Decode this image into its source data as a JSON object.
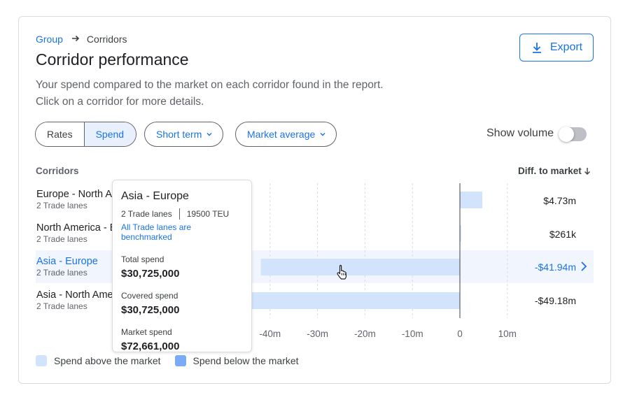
{
  "breadcrumb": {
    "parent": "Group",
    "current": "Corridors"
  },
  "page": {
    "title": "Corridor performance",
    "subtitle_line1": "Your spend compared to the market on each corridor found in the report.",
    "subtitle_line2": "Click on a corridor for more details."
  },
  "toolbar": {
    "export_label": "Export",
    "segments": [
      "Rates",
      "Spend"
    ],
    "active_segment": "Spend",
    "term_dropdown": "Short term",
    "benchmark_dropdown": "Market average",
    "show_volume_label": "Show volume",
    "show_volume_on": false
  },
  "table": {
    "col_left": "Corridors",
    "col_right": "Diff. to market",
    "sort_icon": "arrow-down-icon",
    "rows": [
      {
        "name": "Europe - North America",
        "sub": "2 Trade lanes",
        "value": "$4.73m"
      },
      {
        "name": "North America - Europe",
        "sub": "2 Trade lanes",
        "value": "$261k"
      },
      {
        "name": "Asia - Europe",
        "sub": "2 Trade lanes",
        "value": "-$41.94m"
      },
      {
        "name": "Asia - North America",
        "sub": "2 Trade lanes",
        "value": "-$49.18m"
      }
    ],
    "active_row": 2
  },
  "chart_data": {
    "type": "bar",
    "orientation": "horizontal",
    "categories": [
      "Europe - North America",
      "North America - Europe",
      "Asia - Europe",
      "Asia - North America"
    ],
    "values": [
      4.73,
      0.261,
      -41.94,
      -49.18
    ],
    "unit": "m",
    "xlim": [
      -50,
      10
    ],
    "xticks": [
      -40,
      -30,
      -20,
      -10,
      0,
      10
    ],
    "xtick_labels": [
      "-40m",
      "-30m",
      "-20m",
      "-10m",
      "0",
      "10m"
    ],
    "grid": true
  },
  "tooltip": {
    "title": "Asia - Europe",
    "trade_lanes": "2 Trade lanes",
    "teu": "19500 TEU",
    "benchmark_note": "All Trade lanes are benchmarked",
    "total_spend_label": "Total spend",
    "total_spend_value": "$30,725,000",
    "covered_spend_label": "Covered spend",
    "covered_spend_value": "$30,725,000",
    "market_spend_label": "Market spend",
    "market_spend_value": "$72,661,000"
  },
  "legend": {
    "above": {
      "label": "Spend above the market",
      "color": "#d2e3fc"
    },
    "below": {
      "label": "Spend below the market",
      "color": "#7baaf7"
    }
  },
  "colors": {
    "accent": "#1a73e8",
    "bar_fill": "#d2e3fc",
    "row_highlight": "#f1f5fd"
  }
}
